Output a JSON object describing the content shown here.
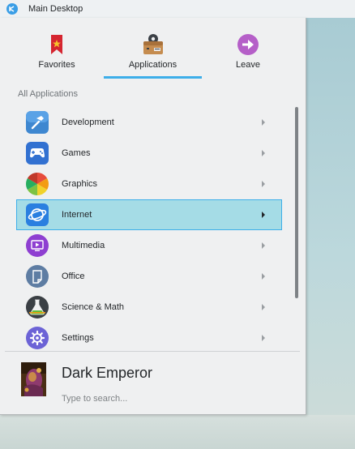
{
  "window": {
    "title": "Main Desktop",
    "icon": "kde-launcher-icon"
  },
  "tabs": [
    {
      "label": "Favorites",
      "icon": "bookmark-icon",
      "active": false
    },
    {
      "label": "Applications",
      "icon": "applications-briefcase-icon",
      "active": true
    },
    {
      "label": "Leave",
      "icon": "leave-arrow-icon",
      "active": false
    }
  ],
  "section_header": "All Applications",
  "apps": [
    {
      "label": "Development",
      "icon": "hammer-icon",
      "selected": false
    },
    {
      "label": "Games",
      "icon": "gamepad-icon",
      "selected": false
    },
    {
      "label": "Graphics",
      "icon": "color-wheel-icon",
      "selected": false
    },
    {
      "label": "Internet",
      "icon": "globe-icon",
      "selected": true
    },
    {
      "label": "Multimedia",
      "icon": "media-player-icon",
      "selected": false
    },
    {
      "label": "Office",
      "icon": "document-icon",
      "selected": false
    },
    {
      "label": "Science & Math",
      "icon": "flask-icon",
      "selected": false
    },
    {
      "label": "Settings",
      "icon": "gear-icon",
      "selected": false
    }
  ],
  "user": {
    "name": "Dark Emperor"
  },
  "search": {
    "placeholder": "Type to search...",
    "value": ""
  },
  "colors": {
    "accent": "#3daee9",
    "selection_bg": "#a5dce6",
    "panel_bg": "#eff0f1"
  }
}
